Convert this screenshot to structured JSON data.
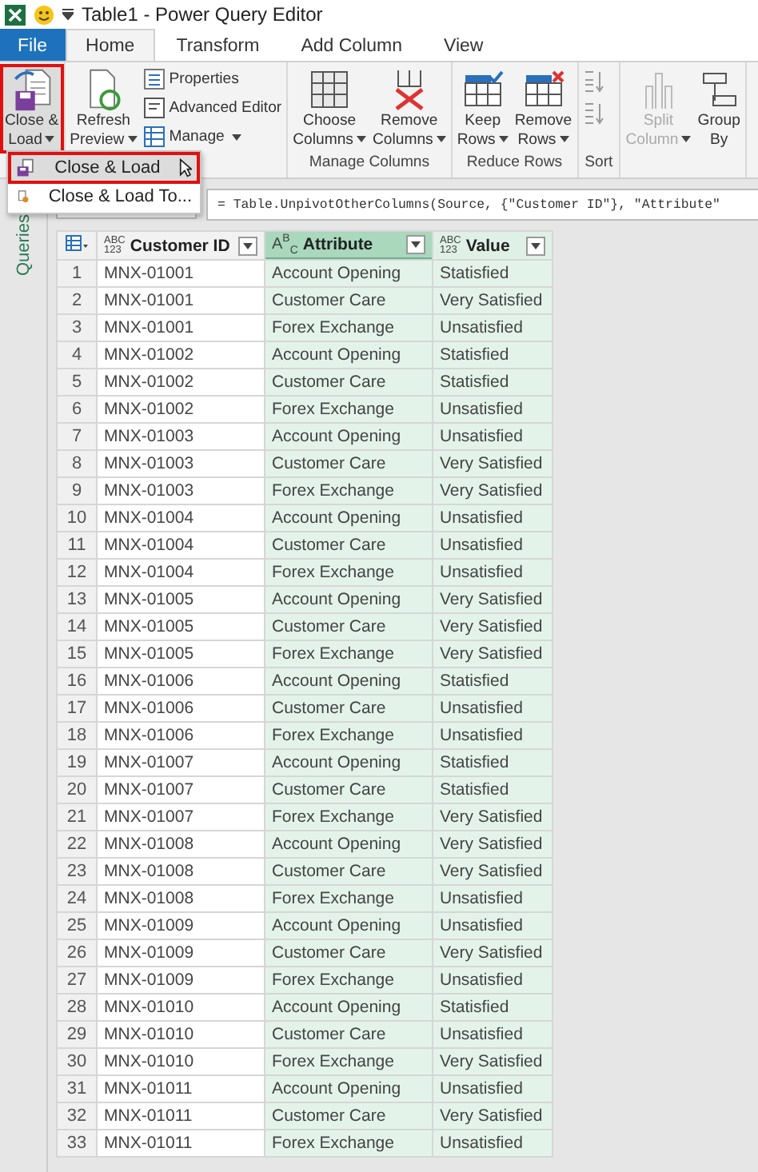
{
  "window": {
    "title": "Table1 - Power Query Editor"
  },
  "tabs": [
    {
      "label": "File",
      "kind": "file",
      "selected": false
    },
    {
      "label": "Home",
      "kind": "tab",
      "selected": true
    },
    {
      "label": "Transform",
      "kind": "tab",
      "selected": false
    },
    {
      "label": "Add Column",
      "kind": "tab",
      "selected": false
    },
    {
      "label": "View",
      "kind": "tab",
      "selected": false
    }
  ],
  "ribbon": {
    "groups": [
      {
        "buttons": [
          {
            "kind": "large",
            "lines": [
              "Close &",
              "Load"
            ],
            "dropdown": true,
            "highlighted": true,
            "disabled": false
          }
        ]
      },
      {
        "buttons": [
          {
            "kind": "large",
            "lines": [
              "Refresh",
              "Preview"
            ],
            "dropdown": true,
            "highlighted": false,
            "disabled": false
          },
          {
            "kind": "stack",
            "items": [
              {
                "label": "Properties",
                "dropdown": false
              },
              {
                "label": "Advanced Editor",
                "dropdown": false
              },
              {
                "label": "Manage",
                "dropdown": true
              }
            ]
          }
        ]
      },
      {
        "label": "Manage Columns",
        "buttons": [
          {
            "kind": "large",
            "lines": [
              "Choose",
              "Columns"
            ],
            "dropdown": true,
            "highlighted": false,
            "disabled": false
          },
          {
            "kind": "large",
            "lines": [
              "Remove",
              "Columns"
            ],
            "dropdown": true,
            "highlighted": false,
            "disabled": false
          }
        ]
      },
      {
        "label": "Reduce Rows",
        "buttons": [
          {
            "kind": "large",
            "lines": [
              "Keep",
              "Rows"
            ],
            "dropdown": true,
            "highlighted": false,
            "disabled": false
          },
          {
            "kind": "large",
            "lines": [
              "Remove",
              "Rows"
            ],
            "dropdown": true,
            "highlighted": false,
            "disabled": false
          }
        ]
      },
      {
        "label": "Sort",
        "buttons": [
          {
            "kind": "sort"
          }
        ]
      },
      {
        "buttons": [
          {
            "kind": "large",
            "lines": [
              "Split",
              "Column"
            ],
            "dropdown": true,
            "highlighted": false,
            "disabled": true
          },
          {
            "kind": "large",
            "lines": [
              "Group",
              "By"
            ],
            "dropdown": false,
            "highlighted": false,
            "disabled": false
          }
        ]
      }
    ]
  },
  "menu": {
    "items": [
      {
        "label": "Close & Load",
        "selected": true,
        "highlighted": true
      },
      {
        "label": "Close & Load To...",
        "selected": false,
        "highlighted": false
      }
    ]
  },
  "formula": {
    "text": "= Table.UnpivotOtherColumns(Source, {\"Customer ID\"}, \"Attribute\""
  },
  "queries_pane": {
    "label": "Queries"
  },
  "table": {
    "columns": [
      {
        "label": "Customer ID",
        "type_icon": {
          "kind": "stack",
          "lines": [
            "ABC",
            "123"
          ]
        },
        "selected": false,
        "focused": false
      },
      {
        "label": "Attribute",
        "type_icon": {
          "kind": "rich",
          "text": "A$^{B}$$_{C}$"
        },
        "selected": true,
        "focused": true
      },
      {
        "label": "Value",
        "type_icon": {
          "kind": "stack",
          "lines": [
            "ABC",
            "123"
          ]
        },
        "selected": true,
        "focused": false
      }
    ],
    "rows": [
      {
        "number": "1",
        "cells": [
          "MNX-01001",
          "Account Opening",
          "Statisfied"
        ]
      },
      {
        "number": "2",
        "cells": [
          "MNX-01001",
          "Customer Care",
          "Very Satisfied"
        ]
      },
      {
        "number": "3",
        "cells": [
          "MNX-01001",
          "Forex Exchange",
          "Unsatisfied"
        ]
      },
      {
        "number": "4",
        "cells": [
          "MNX-01002",
          "Account Opening",
          "Statisfied"
        ]
      },
      {
        "number": "5",
        "cells": [
          "MNX-01002",
          "Customer Care",
          "Statisfied"
        ]
      },
      {
        "number": "6",
        "cells": [
          "MNX-01002",
          "Forex Exchange",
          "Unsatisfied"
        ]
      },
      {
        "number": "7",
        "cells": [
          "MNX-01003",
          "Account Opening",
          "Unsatisfied"
        ]
      },
      {
        "number": "8",
        "cells": [
          "MNX-01003",
          "Customer Care",
          "Very Satisfied"
        ]
      },
      {
        "number": "9",
        "cells": [
          "MNX-01003",
          "Forex Exchange",
          "Very Satisfied"
        ]
      },
      {
        "number": "10",
        "cells": [
          "MNX-01004",
          "Account Opening",
          "Unsatisfied"
        ]
      },
      {
        "number": "11",
        "cells": [
          "MNX-01004",
          "Customer Care",
          "Unsatisfied"
        ]
      },
      {
        "number": "12",
        "cells": [
          "MNX-01004",
          "Forex Exchange",
          "Unsatisfied"
        ]
      },
      {
        "number": "13",
        "cells": [
          "MNX-01005",
          "Account Opening",
          "Very Satisfied"
        ]
      },
      {
        "number": "14",
        "cells": [
          "MNX-01005",
          "Customer Care",
          "Very Satisfied"
        ]
      },
      {
        "number": "15",
        "cells": [
          "MNX-01005",
          "Forex Exchange",
          "Very Satisfied"
        ]
      },
      {
        "number": "16",
        "cells": [
          "MNX-01006",
          "Account Opening",
          "Statisfied"
        ]
      },
      {
        "number": "17",
        "cells": [
          "MNX-01006",
          "Customer Care",
          "Unsatisfied"
        ]
      },
      {
        "number": "18",
        "cells": [
          "MNX-01006",
          "Forex Exchange",
          "Unsatisfied"
        ]
      },
      {
        "number": "19",
        "cells": [
          "MNX-01007",
          "Account Opening",
          "Statisfied"
        ]
      },
      {
        "number": "20",
        "cells": [
          "MNX-01007",
          "Customer Care",
          "Statisfied"
        ]
      },
      {
        "number": "21",
        "cells": [
          "MNX-01007",
          "Forex Exchange",
          "Very Satisfied"
        ]
      },
      {
        "number": "22",
        "cells": [
          "MNX-01008",
          "Account Opening",
          "Very Satisfied"
        ]
      },
      {
        "number": "23",
        "cells": [
          "MNX-01008",
          "Customer Care",
          "Very Satisfied"
        ]
      },
      {
        "number": "24",
        "cells": [
          "MNX-01008",
          "Forex Exchange",
          "Unsatisfied"
        ]
      },
      {
        "number": "25",
        "cells": [
          "MNX-01009",
          "Account Opening",
          "Unsatisfied"
        ]
      },
      {
        "number": "26",
        "cells": [
          "MNX-01009",
          "Customer Care",
          "Very Satisfied"
        ]
      },
      {
        "number": "27",
        "cells": [
          "MNX-01009",
          "Forex Exchange",
          "Unsatisfied"
        ]
      },
      {
        "number": "28",
        "cells": [
          "MNX-01010",
          "Account Opening",
          "Statisfied"
        ]
      },
      {
        "number": "29",
        "cells": [
          "MNX-01010",
          "Customer Care",
          "Unsatisfied"
        ]
      },
      {
        "number": "30",
        "cells": [
          "MNX-01010",
          "Forex Exchange",
          "Very Satisfied"
        ]
      },
      {
        "number": "31",
        "cells": [
          "MNX-01011",
          "Account Opening",
          "Unsatisfied"
        ]
      },
      {
        "number": "32",
        "cells": [
          "MNX-01011",
          "Customer Care",
          "Very Satisfied"
        ]
      },
      {
        "number": "33",
        "cells": [
          "MNX-01011",
          "Forex Exchange",
          "Unsatisfied"
        ]
      }
    ]
  }
}
